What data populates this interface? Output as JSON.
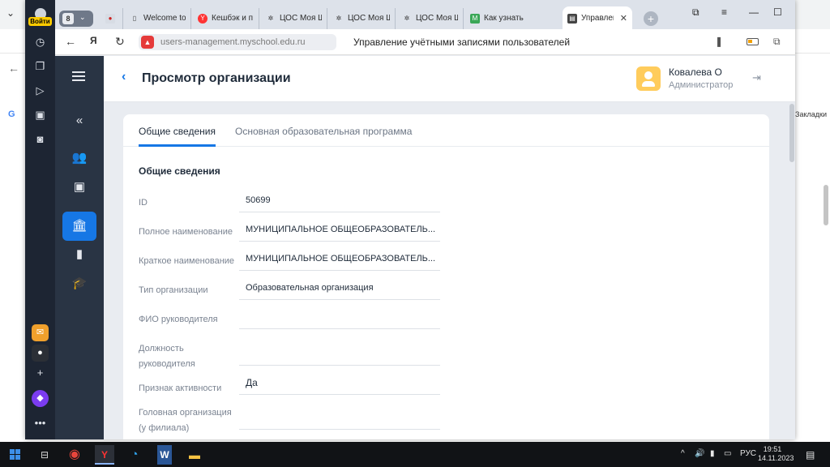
{
  "browser": {
    "login_label": "Войти",
    "tab_group_badge": "8",
    "tabs": [
      {
        "title": "Welcome to",
        "favicon": "document-icon"
      },
      {
        "title": "Кешбэк и п",
        "favicon": "yandex-icon"
      },
      {
        "title": "ЦОС Моя Ш",
        "favicon": "react-icon"
      },
      {
        "title": "ЦОС Моя Ш",
        "favicon": "react-icon"
      },
      {
        "title": "ЦОС Моя Ш",
        "favicon": "react-icon"
      },
      {
        "title": "Как узнать",
        "favicon": "m-icon"
      },
      {
        "title": "Управлен",
        "favicon": "app-icon",
        "active": true
      }
    ],
    "url": "users-management.myschool.edu.ru",
    "page_title": "Управление учётными записями пользователей",
    "bookmarks_hint": "Закладки"
  },
  "header": {
    "title": "Просмотр организации",
    "user_name": "Ковалева О",
    "user_role": "Администратор"
  },
  "card": {
    "tabs": [
      "Общие сведения",
      "Основная образовательная программа"
    ],
    "active_tab": 0,
    "section_title": "Общие сведения",
    "fields": [
      {
        "label": "ID",
        "value": "50699"
      },
      {
        "label": "Полное наименование",
        "value": "МУНИЦИПАЛЬНОЕ ОБЩЕОБРАЗОВАТЕЛЬ..."
      },
      {
        "label": "Краткое наименование",
        "value": "МУНИЦИПАЛЬНОЕ ОБЩЕОБРАЗОВАТЕЛЬ..."
      },
      {
        "label": "Тип организации",
        "value": "Образовательная организация"
      },
      {
        "label": "ФИО руководителя",
        "value": ""
      },
      {
        "label": "Должность руководителя",
        "value": ""
      },
      {
        "label": "Признак активности",
        "value": "Да"
      },
      {
        "label": "Головная организация (у филиала)",
        "value": ""
      }
    ]
  },
  "taskbar": {
    "language": "РУС",
    "time": "19:51",
    "date": "14.11.2023"
  },
  "colors": {
    "accent": "#1677e5",
    "sidebar": "#293444",
    "browser_panel": "#1d2533"
  }
}
